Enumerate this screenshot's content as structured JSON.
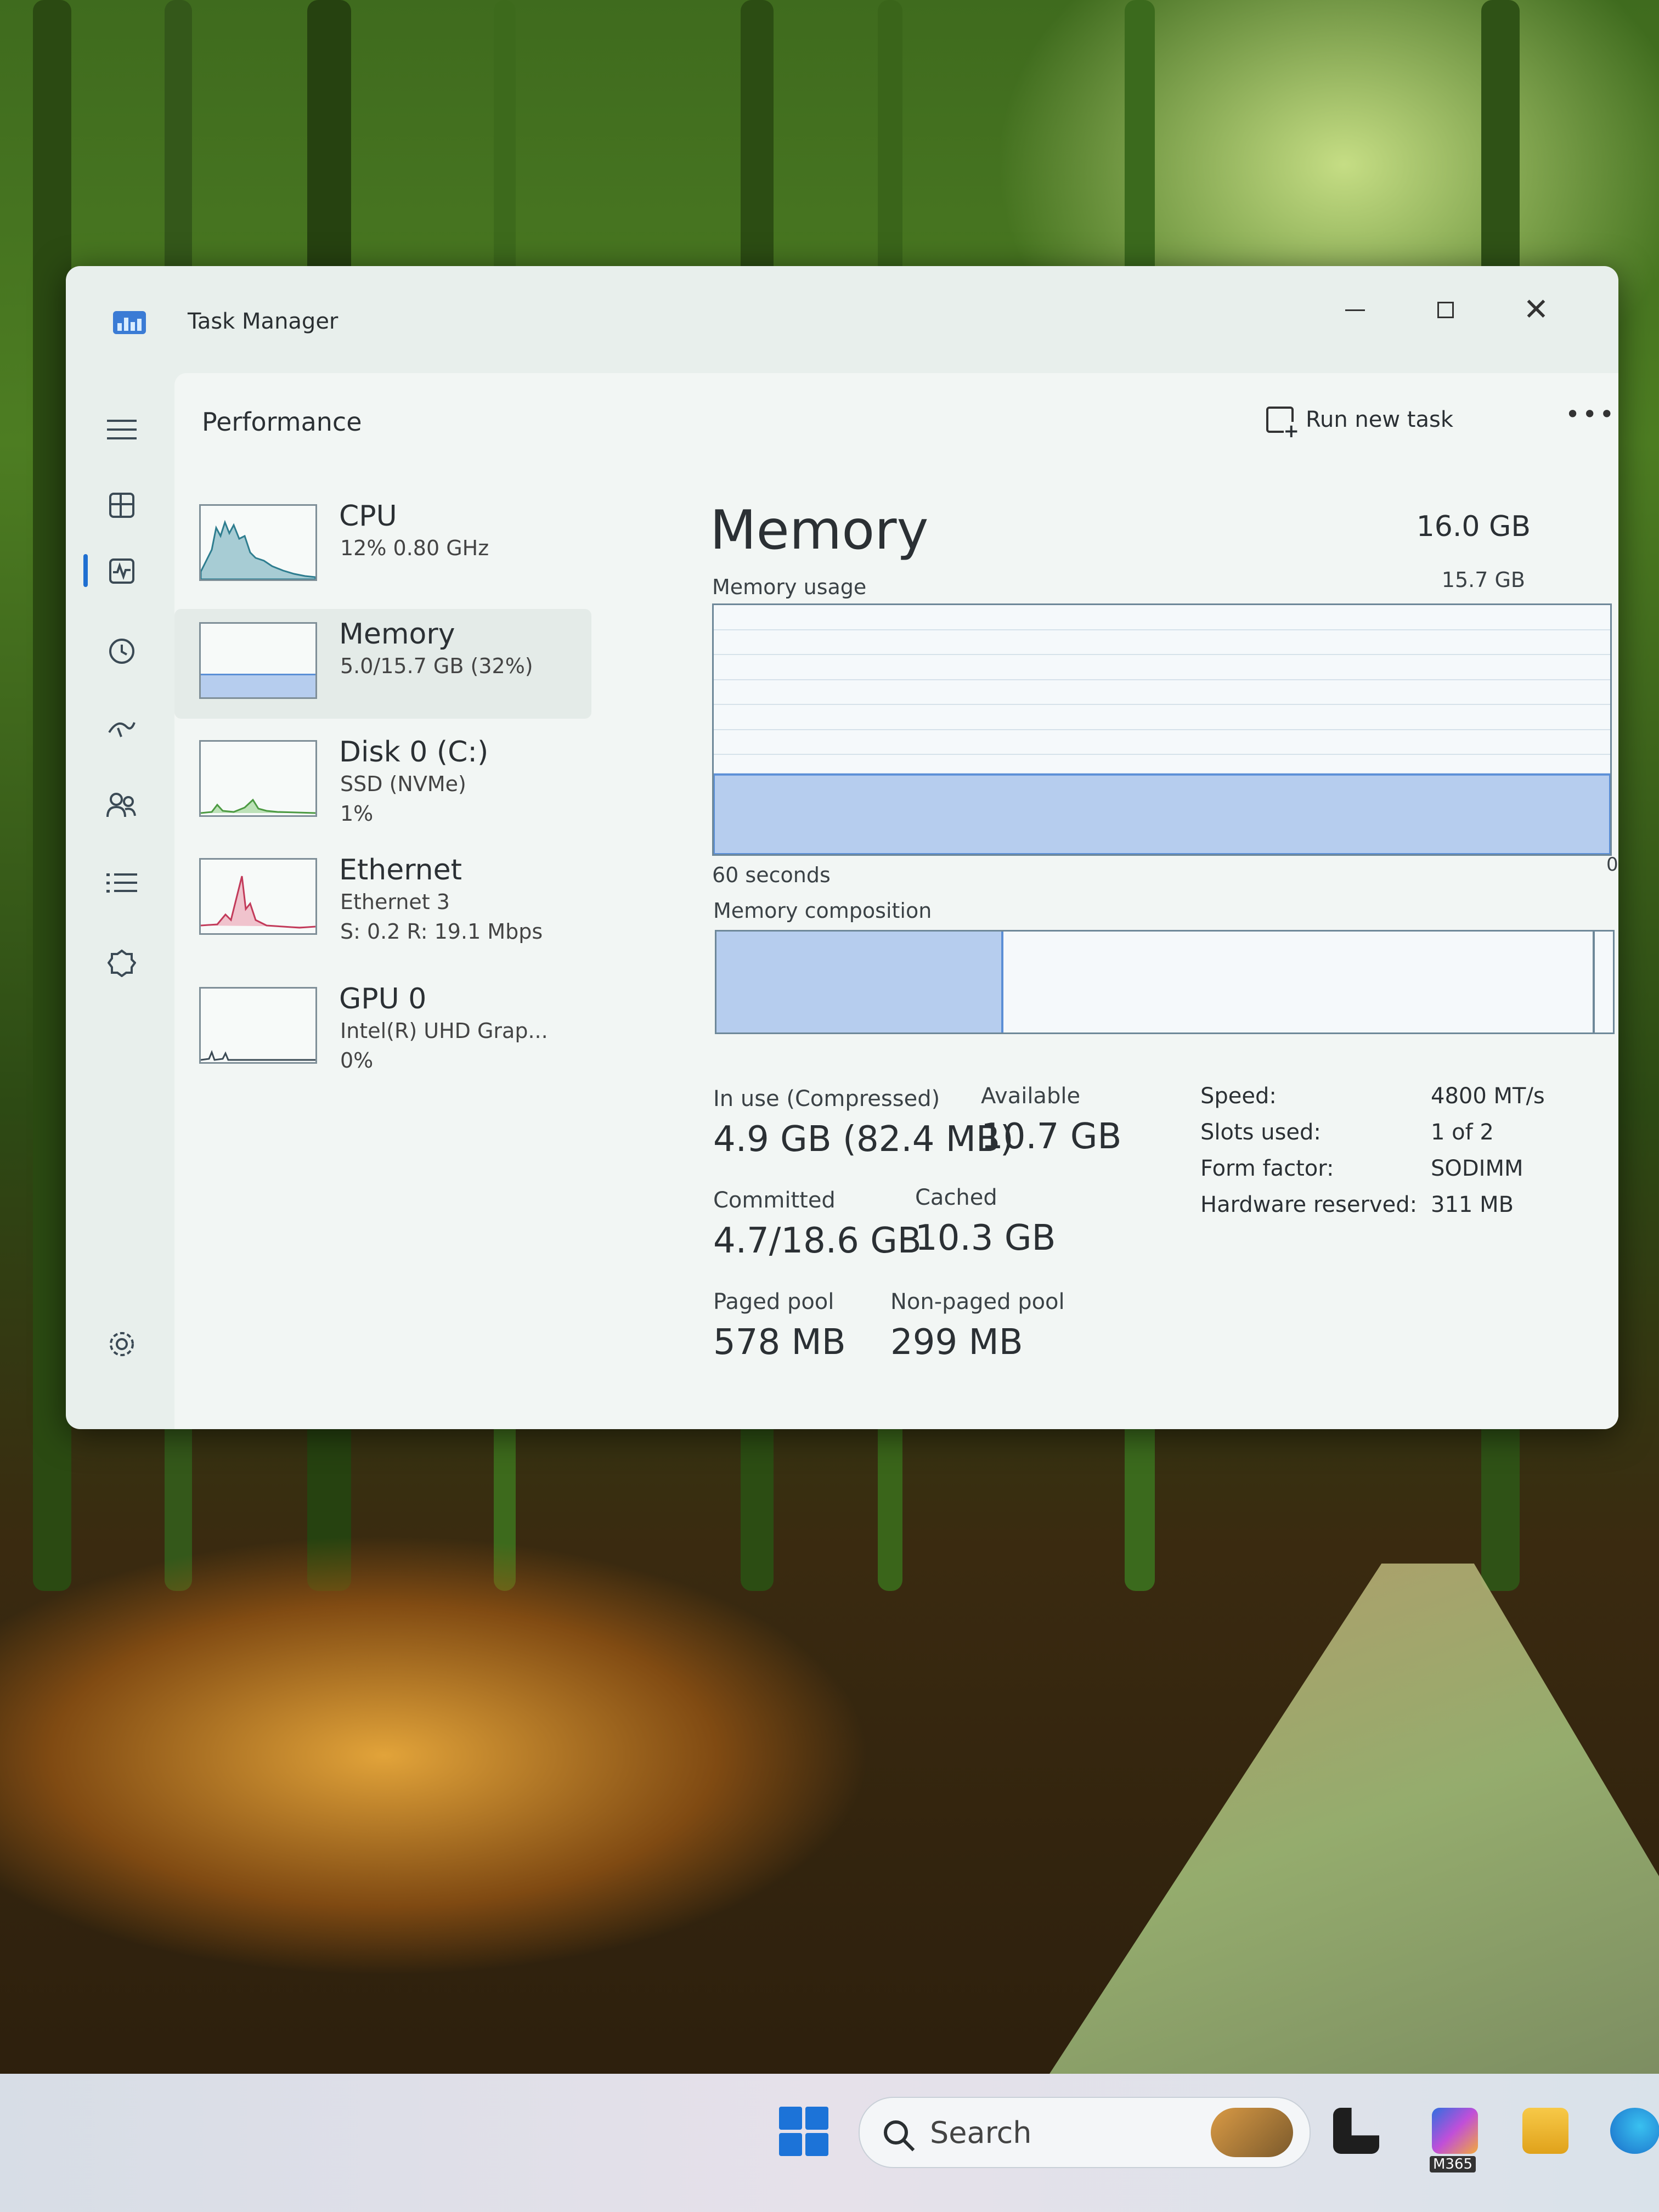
{
  "window": {
    "title": "Task Manager"
  },
  "header": {
    "page_title": "Performance",
    "run_new_task": "Run new task"
  },
  "nav": [
    "hamburger-icon",
    "processes-icon",
    "performance-icon",
    "app-history-icon",
    "startup-apps-icon",
    "users-icon",
    "details-icon",
    "services-icon",
    "settings-icon"
  ],
  "devices": [
    {
      "name": "CPU",
      "line2": "12% 0.80 GHz",
      "line3": ""
    },
    {
      "name": "Memory",
      "line2": "5.0/15.7 GB (32%)",
      "line3": ""
    },
    {
      "name": "Disk 0 (C:)",
      "line2": "SSD (NVMe)",
      "line3": "1%"
    },
    {
      "name": "Ethernet",
      "line2": "Ethernet 3",
      "line3": "S: 0.2 R: 19.1 Mbps"
    },
    {
      "name": "GPU 0",
      "line2": "Intel(R) UHD Grap...",
      "line3": "0%"
    }
  ],
  "memory": {
    "title": "Memory",
    "total": "16.0 GB",
    "usage_label": "Memory usage",
    "usage_max": "15.7 GB",
    "x_label": "60 seconds",
    "y_min": "0",
    "composition_label": "Memory composition",
    "usage_fraction": 0.32,
    "composition": {
      "in_use_fraction": 0.32,
      "modified_fraction": 0.66,
      "standby_fraction": 0.02
    },
    "stats": {
      "in_use_label": "In use (Compressed)",
      "in_use_value": "4.9 GB (82.4 MB)",
      "available_label": "Available",
      "available_value": "10.7 GB",
      "committed_label": "Committed",
      "committed_value": "4.7/18.6 GB",
      "cached_label": "Cached",
      "cached_value": "10.3 GB",
      "paged_label": "Paged pool",
      "paged_value": "578 MB",
      "nonpaged_label": "Non-paged pool",
      "nonpaged_value": "299 MB"
    },
    "specs": [
      {
        "label": "Speed:",
        "value": "4800 MT/s"
      },
      {
        "label": "Slots used:",
        "value": "1 of 2"
      },
      {
        "label": "Form factor:",
        "value": "SODIMM"
      },
      {
        "label": "Hardware reserved:",
        "value": "311 MB"
      }
    ]
  },
  "taskbar": {
    "search_placeholder": "Search",
    "m365_label": "M365"
  },
  "colors": {
    "accent": "#1f6fd1",
    "memory_fill": "#b6cdee",
    "memory_line": "#5b8fd6",
    "ethernet_line": "#c23a5a",
    "cpu_line": "#2e7d8f"
  }
}
